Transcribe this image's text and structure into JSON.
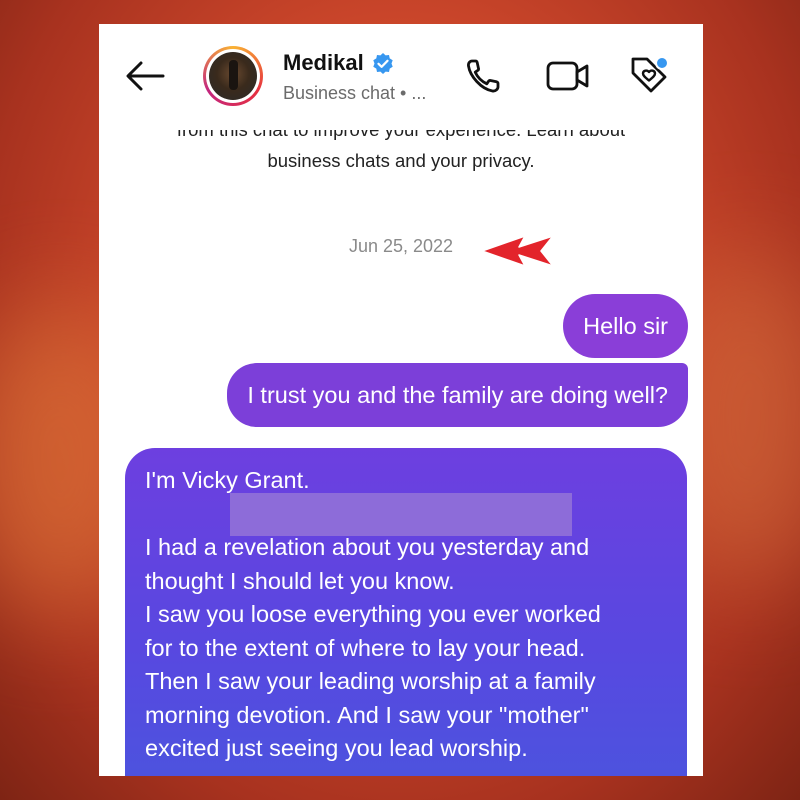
{
  "header": {
    "name": "Medikal",
    "subtitle": "Business chat • ..."
  },
  "notice": {
    "line1": "from this chat to improve your experience.",
    "link1": "Learn about",
    "link2": "business chats and your privacy."
  },
  "date_stamp": "Jun 25, 2022",
  "messages": [
    {
      "text": "Hello sir"
    },
    {
      "text": "I trust you and the family are doing well?"
    },
    {
      "lines": [
        "I'm Vicky Grant.",
        "I had a revelation about you yesterday and",
        "thought I should let you know.",
        "I saw you loose everything you ever worked",
        "for to the extent of where to lay your head.",
        "Then I saw your leading worship at a family",
        "morning devotion. And I saw your \"mother\"",
        "excited just seeing you lead worship."
      ]
    }
  ],
  "colors": {
    "sent_bubble": "#8a3ed8",
    "received_gradient_top": "#6d3fe0",
    "received_gradient_bottom": "#4a55de",
    "verified": "#3797f0",
    "annotation_arrow": "#e3242b"
  },
  "icons": [
    "back-arrow-icon",
    "verified-badge-icon",
    "phone-call-icon",
    "video-camera-icon",
    "tag-heart-icon",
    "red-pointer-arrow-icon"
  ]
}
